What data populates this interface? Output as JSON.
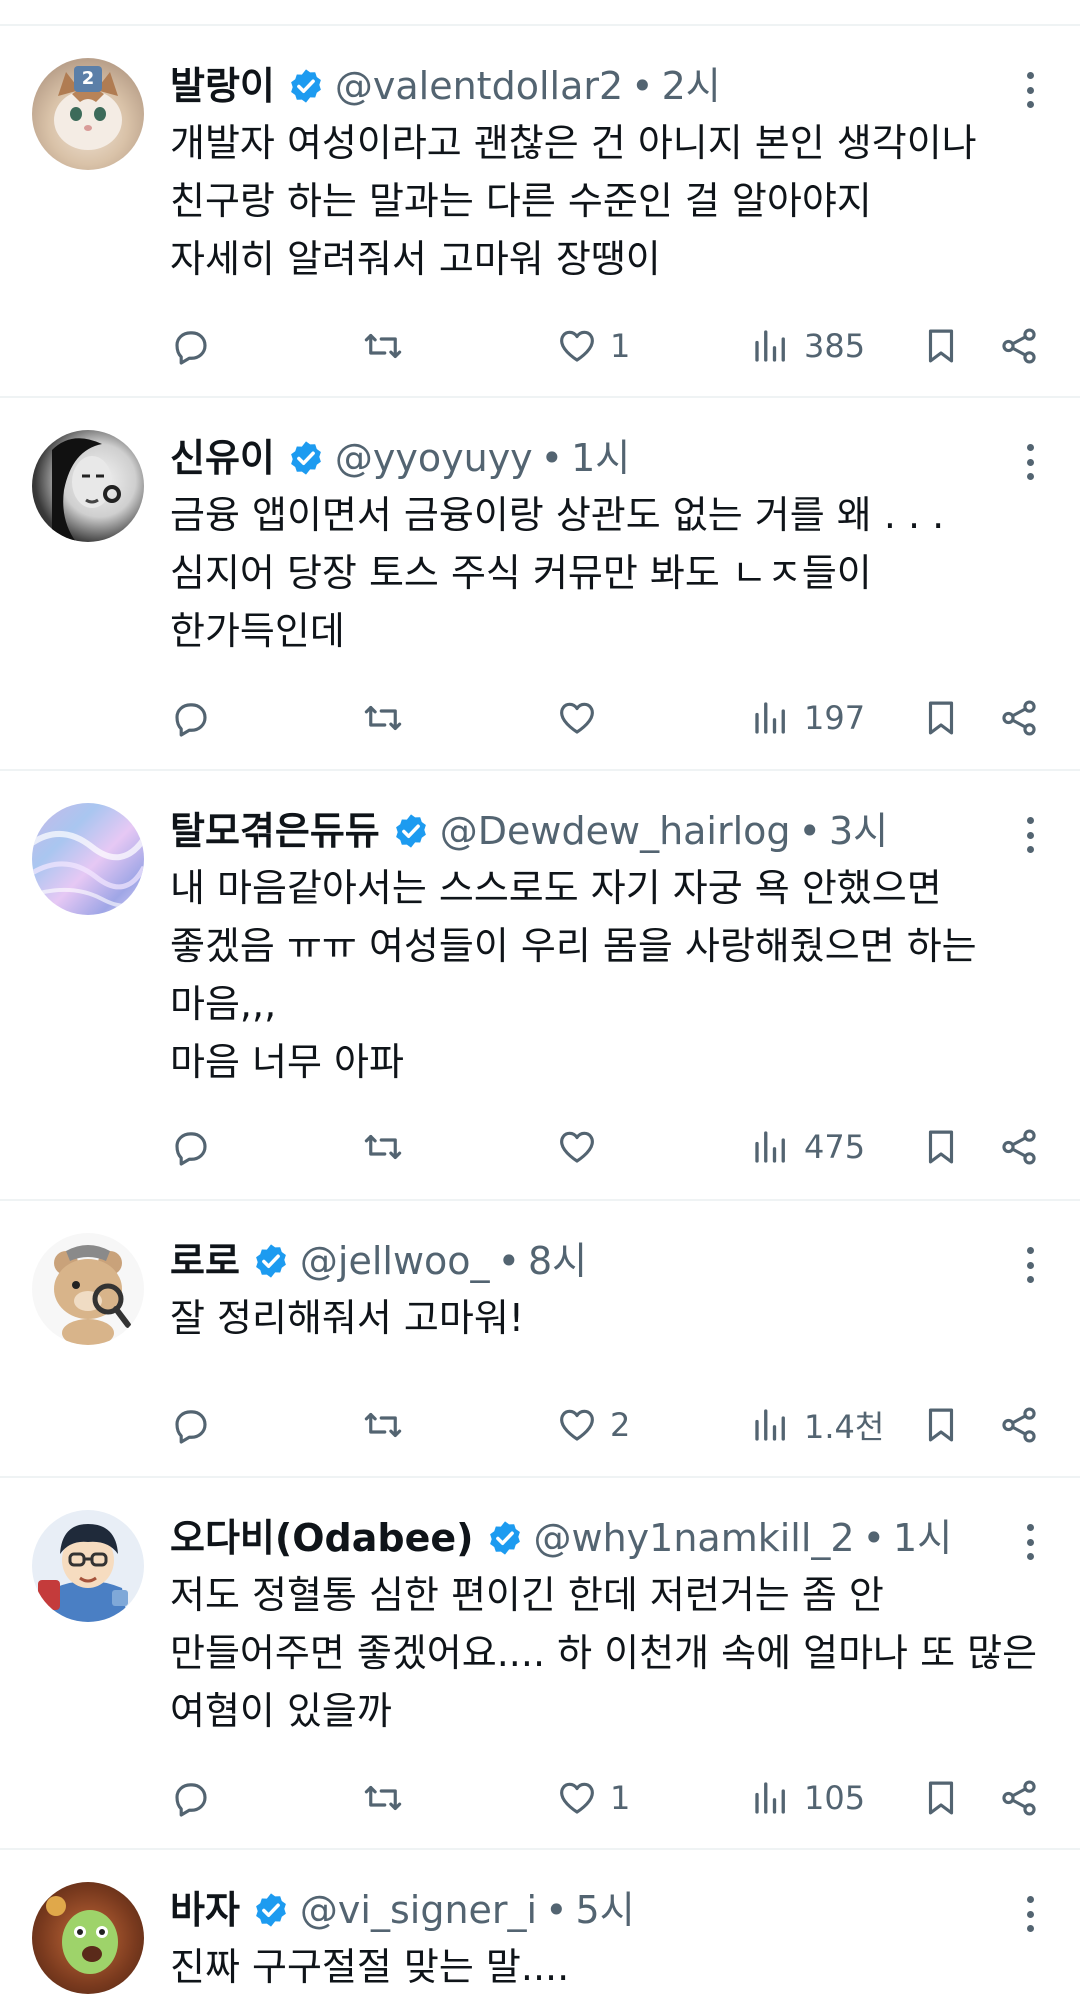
{
  "colors": {
    "verified": "#1d9bf0",
    "text": "#0f1419",
    "muted": "#536471",
    "divider": "#eff3f4"
  },
  "icons": {
    "reply": "reply-icon",
    "retweet": "retweet-icon",
    "like": "heart-icon",
    "views": "views-icon",
    "bookmark": "bookmark-icon",
    "share": "share-icon",
    "more": "more-icon",
    "verified": "verified-badge-icon"
  },
  "tweets": [
    {
      "name": "발랑이",
      "handle": "@valentdollar2",
      "dot": "•",
      "time": "2시",
      "avatar_badge": "2",
      "text": "개발자 여성이라고 괜찮은 건 아니지 본인 생각이나\n친구랑 하는 말과는 다른 수준인 걸 알아야지\n자세히 알려줘서 고마워 장땡이",
      "likes": "1",
      "views": "385"
    },
    {
      "name": "신유이",
      "handle": "@yyoyuyy",
      "dot": "•",
      "time": "1시",
      "text": "금융 앱이면서 금융이랑 상관도 없는 거를 왜 . . .\n심지어 당장 토스 주식 커뮤만 봐도 ㄴㅈ들이\n한가득인데",
      "likes": "",
      "views": "197"
    },
    {
      "name": "탈모겪은듀듀",
      "handle": "@Dewdew_hairlog",
      "dot": "•",
      "time": "3시",
      "text": "내 마음같아서는 스스로도 자기 자궁 욕 안했으면\n좋겠음 ㅠㅠ 여성들이 우리 몸을 사랑해줬으면 하는\n마음,,,\n마음 너무 아파",
      "likes": "",
      "views": "475"
    },
    {
      "name": "로로",
      "handle": "@jellwoo_",
      "dot": "•",
      "time": "8시",
      "text": "잘 정리해줘서 고마워!",
      "likes": "2",
      "views": "1.4천"
    },
    {
      "name": "오다비(Odabee)",
      "handle": "@why1namkill_2",
      "dot": "•",
      "time": "1시",
      "text": "저도 정혈통 심한 편이긴 한데 저런거는 좀 안\n만들어주면 좋겠어요.... 하 이천개 속에 얼마나 또 많은\n여혐이 있을까",
      "likes": "1",
      "views": "105"
    },
    {
      "name": "바자",
      "handle": "@vi_signer_i",
      "dot": "•",
      "time": "5시",
      "text": "진짜 구구절절 맞는 말....",
      "likes": "",
      "views": ""
    }
  ]
}
